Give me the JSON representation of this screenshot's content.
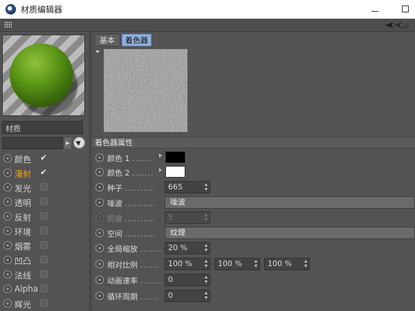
{
  "window": {
    "title": "材质编辑器"
  },
  "material": {
    "name": "材质"
  },
  "channels": [
    {
      "label": "颜色",
      "checked": true,
      "active": false
    },
    {
      "label": "漫射",
      "checked": true,
      "active": true
    },
    {
      "label": "发光",
      "checked": false,
      "active": false
    },
    {
      "label": "透明",
      "checked": false,
      "active": false
    },
    {
      "label": "反射",
      "checked": false,
      "active": false
    },
    {
      "label": "环境",
      "checked": false,
      "active": false
    },
    {
      "label": "烟雾",
      "checked": false,
      "active": false
    },
    {
      "label": "凹凸",
      "checked": false,
      "active": false
    },
    {
      "label": "法线",
      "checked": false,
      "active": false
    },
    {
      "label": "Alpha",
      "checked": false,
      "active": false
    },
    {
      "label": "辉光",
      "checked": false,
      "active": false
    }
  ],
  "tabs": {
    "basic": "基本",
    "shader": "着色器"
  },
  "section": {
    "title": "着色器属性"
  },
  "params": {
    "color1": {
      "label": "颜色 1",
      "dots": ".......",
      "value": "#000000"
    },
    "color2": {
      "label": "颜色 2",
      "dots": ".......",
      "value": "#ffffff"
    },
    "seed": {
      "label": "种子",
      "dots": "..........",
      "value": "665"
    },
    "noise": {
      "label": "噪波",
      "dots": "..........",
      "value": "噪波"
    },
    "octaves": {
      "label": "阶度",
      "dots": "..........",
      "value": "5"
    },
    "space": {
      "label": "空间",
      "dots": "..........",
      "value": "纹理"
    },
    "global_scale": {
      "label": "全局缩放",
      "dots": ".......",
      "value": "20 %"
    },
    "relative_scale": {
      "label": "相对比例",
      "dots": "......",
      "values": [
        "100 %",
        "100 %",
        "100 %"
      ]
    },
    "anim_speed": {
      "label": "动画速率",
      "dots": ".......",
      "value": "0"
    },
    "loop_period": {
      "label": "循环周期",
      "dots": "......",
      "value": "0"
    }
  }
}
